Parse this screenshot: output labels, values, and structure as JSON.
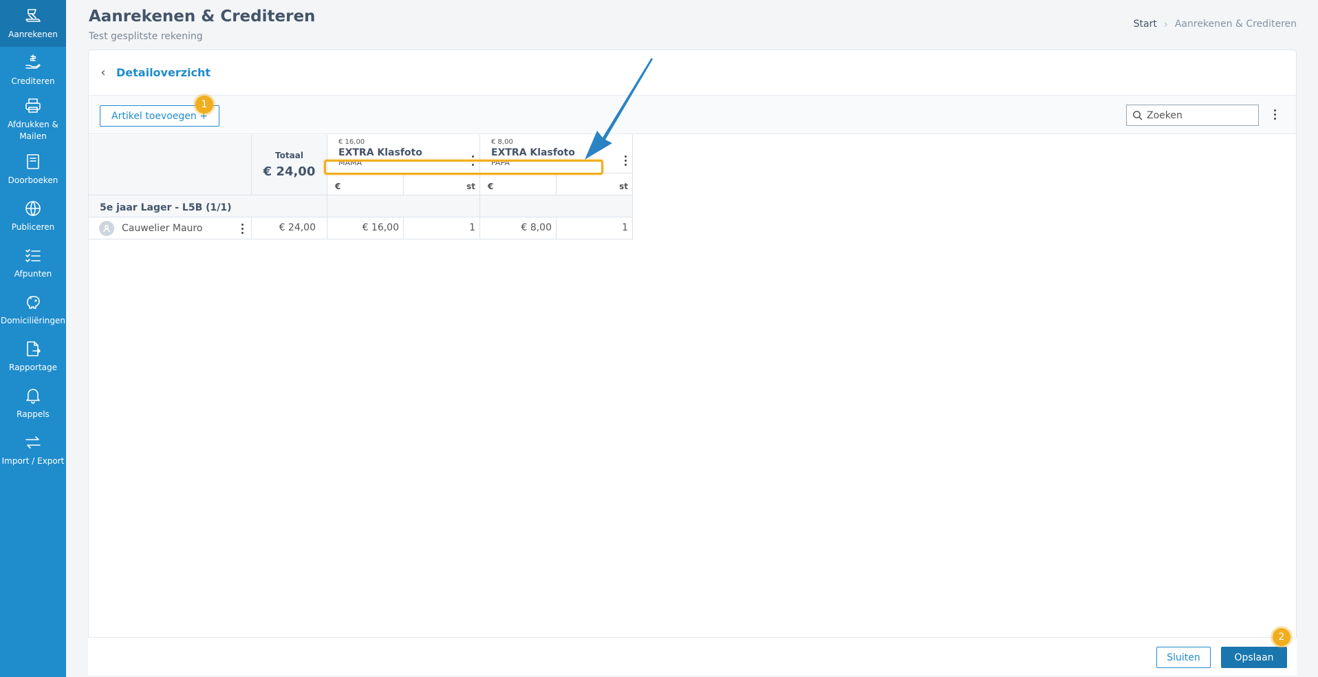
{
  "sidebar": {
    "items": [
      {
        "label": "Aanrekenen",
        "icon": "invoice-icon"
      },
      {
        "label": "Crediteren",
        "icon": "hand-money-icon"
      },
      {
        "label": "Afdrukken & Mailen",
        "icon": "printer-icon"
      },
      {
        "label": "Doorboeken",
        "icon": "book-icon"
      },
      {
        "label": "Publiceren",
        "icon": "globe-icon"
      },
      {
        "label": "Afpunten",
        "icon": "checklist-icon"
      },
      {
        "label": "Domiciliëringen",
        "icon": "piggy-bank-icon"
      },
      {
        "label": "Rapportage",
        "icon": "report-icon"
      },
      {
        "label": "Rappels",
        "icon": "bell-icon"
      },
      {
        "label": "Import / Export",
        "icon": "transfer-icon"
      }
    ]
  },
  "header": {
    "title": "Aanrekenen & Crediteren",
    "subtitle": "Test gesplitste rekening",
    "breadcrumb": [
      "Start",
      "Aanrekenen & Crediteren"
    ]
  },
  "card": {
    "title": "Detailoverzicht",
    "add_button": "Artikel toevoegen +",
    "search_placeholder": "Zoeken",
    "badges": [
      "1",
      "2"
    ]
  },
  "table": {
    "total_label": "Totaal",
    "total_value": "€ 24,00",
    "articles": [
      {
        "price": "€ 16,00",
        "name": "EXTRA Klasfoto",
        "sub": "MAMA",
        "unit_money": "€",
        "unit_qty": "st"
      },
      {
        "price": "€ 8,00",
        "name": "EXTRA Klasfoto",
        "sub": "PAPA",
        "unit_money": "€",
        "unit_qty": "st"
      }
    ],
    "group": "5e jaar Lager - L5B (1/1)",
    "rows": [
      {
        "name": "Cauwelier Mauro",
        "total": "€ 24,00",
        "cells": [
          {
            "amount": "€ 16,00",
            "qty": "1"
          },
          {
            "amount": "€ 8,00",
            "qty": "1"
          }
        ]
      }
    ]
  },
  "footer": {
    "close_label": "Sluiten",
    "save_label": "Opslaan"
  },
  "colors": {
    "sidebar": "#1f8ccc",
    "sidebar_active": "#1a76ae",
    "accent": "#1f8ccc",
    "highlight": "#f0ad1e",
    "arrow": "#1a6fb0"
  }
}
